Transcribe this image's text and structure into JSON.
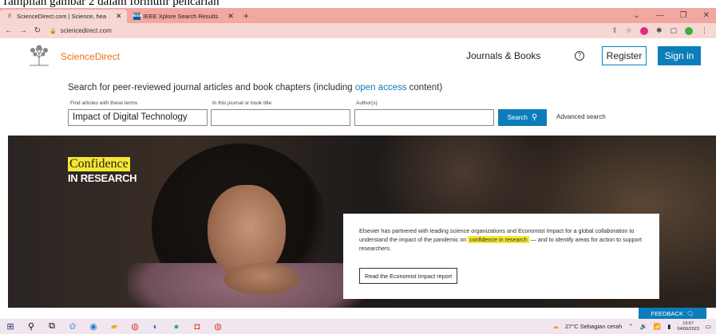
{
  "doc_caption": "Tampilan gambar 2 dalam formulir pencarian",
  "browser": {
    "tabs": [
      {
        "title": "ScienceDirect.com | Science, hea",
        "active": true
      },
      {
        "title": "IEEE Xplore Search Results",
        "active": false
      }
    ],
    "new_tab": "+",
    "url": "sciencedirect.com"
  },
  "header": {
    "brand": "ScienceDirect",
    "journals_books": "Journals & Books",
    "help": "?",
    "register": "Register",
    "sign_in": "Sign in"
  },
  "search": {
    "heading_pre": "Search for peer-reviewed journal articles and book chapters (including ",
    "heading_link": "open access",
    "heading_post": " content)",
    "terms_label": "Find articles with these terms",
    "terms_value": "Impact of Digital Technology",
    "journal_label": "In this journal or book title",
    "journal_value": "",
    "author_label": "Author(s)",
    "author_value": "",
    "search_button": "Search",
    "advanced": "Advanced search"
  },
  "hero": {
    "title_highlight": "Confidence",
    "title_sub": "IN RESEARCH",
    "card_text_1": "Elsevier has partnered with leading science organizations and Economist Impact for a global collaboration to understand the impact of the pandemic on ",
    "card_highlight": "confidence in research",
    "card_text_2": " — and to identify areas for action to support researchers.",
    "card_button": "Read the Economist Impact report"
  },
  "feedback": "FEEDBACK",
  "taskbar": {
    "weather": "27°C  Sebagian cerah",
    "time": "13:57",
    "date": "04/06/2023"
  },
  "colors": {
    "accent": "#0c7dbb",
    "brand_orange": "#e9711c",
    "highlight_yellow": "#f6e733",
    "tab_strip": "#f2a7a0"
  }
}
